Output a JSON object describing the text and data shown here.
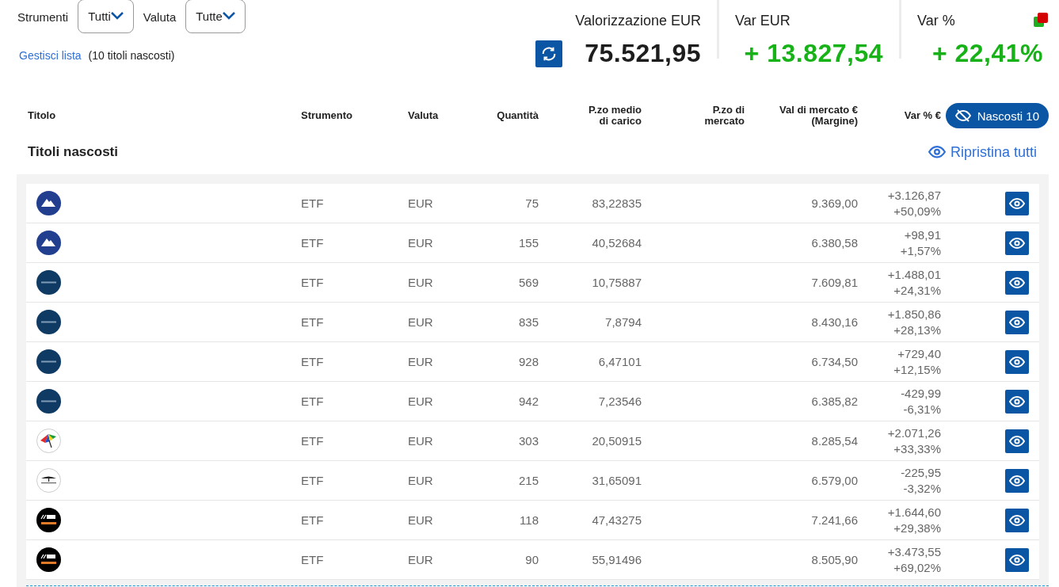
{
  "filters": [
    {
      "label": "Strumenti",
      "value": "Tutti"
    },
    {
      "label": "Valuta",
      "value": "Tutte"
    }
  ],
  "manage": {
    "link": "Gestisci lista",
    "note": "(10 titoli nascosti)"
  },
  "summary": [
    {
      "kind": "total",
      "title": "Valorizzazione EUR",
      "value": "75.521,95"
    },
    {
      "kind": "gain",
      "title": "Var EUR",
      "value": "+ 13.827,54"
    },
    {
      "kind": "gain",
      "title": "Var %",
      "value": "+ 22,41%"
    }
  ],
  "table": {
    "columns": [
      "Titolo",
      "Strumento",
      "Valuta",
      "Quantità",
      "P.zo medio\ndi carico",
      "P.zo di\nmercato",
      "Val di mercato €\n(Margine)",
      "Var % €"
    ],
    "hidden_button": "Nascosti 10",
    "section_title": "Titoli nascosti",
    "restore_all": "Ripristina tutti",
    "rows": [
      {
        "kind": "mountain",
        "instrument": "ETF",
        "currency": "EUR",
        "quantity": "75",
        "avg_price": "83,22835",
        "market_value": "9.369,00",
        "var_eur": "+3.126,87",
        "var_pct": "+50,09%"
      },
      {
        "kind": "mountain",
        "instrument": "ETF",
        "currency": "EUR",
        "quantity": "155",
        "avg_price": "40,52684",
        "market_value": "6.380,58",
        "var_eur": "+98,91",
        "var_pct": "+1,57%"
      },
      {
        "kind": "rock",
        "instrument": "ETF",
        "currency": "EUR",
        "quantity": "569",
        "avg_price": "10,75887",
        "market_value": "7.609,81",
        "var_eur": "+1.488,01",
        "var_pct": "+24,31%"
      },
      {
        "kind": "rock",
        "instrument": "ETF",
        "currency": "EUR",
        "quantity": "835",
        "avg_price": "7,8794",
        "market_value": "8.430,16",
        "var_eur": "+1.850,86",
        "var_pct": "+28,13%"
      },
      {
        "kind": "rock",
        "instrument": "ETF",
        "currency": "EUR",
        "quantity": "928",
        "avg_price": "6,47101",
        "market_value": "6.734,50",
        "var_eur": "+729,40",
        "var_pct": "+12,15%"
      },
      {
        "kind": "rock",
        "instrument": "ETF",
        "currency": "EUR",
        "quantity": "942",
        "avg_price": "7,23546",
        "market_value": "6.385,82",
        "var_eur": "-429,99",
        "var_pct": "-6,31%"
      },
      {
        "kind": "umbrella",
        "instrument": "ETF",
        "currency": "EUR",
        "quantity": "303",
        "avg_price": "20,50915",
        "market_value": "8.285,54",
        "var_eur": "+2.071,26",
        "var_pct": "+33,33%"
      },
      {
        "kind": "tree",
        "instrument": "ETF",
        "currency": "EUR",
        "quantity": "215",
        "avg_price": "31,65091",
        "market_value": "6.579,00",
        "var_eur": "-225,95",
        "var_pct": "-3,32%"
      },
      {
        "kind": "stripes",
        "instrument": "ETF",
        "currency": "EUR",
        "quantity": "118",
        "avg_price": "47,43275",
        "market_value": "7.241,66",
        "var_eur": "+1.644,60",
        "var_pct": "+29,38%"
      },
      {
        "kind": "stripes",
        "instrument": "ETF",
        "currency": "EUR",
        "quantity": "90",
        "avg_price": "55,91496",
        "market_value": "8.505,90",
        "var_eur": "+3.473,55",
        "var_pct": "+69,02%"
      }
    ]
  }
}
